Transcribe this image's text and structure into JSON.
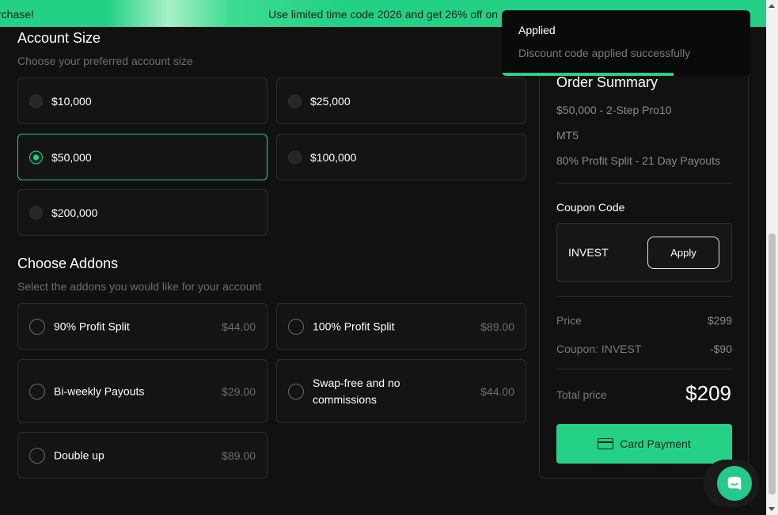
{
  "banner": {
    "left_text": "rchase!",
    "center_text": "Use limited time code 2026 and get 26% off on"
  },
  "account_size": {
    "title": "Account Size",
    "subtitle": "Choose your preferred account size",
    "options": [
      {
        "label": "$10,000",
        "selected": false
      },
      {
        "label": "$25,000",
        "selected": false
      },
      {
        "label": "$50,000",
        "selected": true
      },
      {
        "label": "$100,000",
        "selected": false
      },
      {
        "label": "$200,000",
        "selected": false
      }
    ]
  },
  "addons": {
    "title": "Choose Addons",
    "subtitle": "Select the addons you would like for your account",
    "options": [
      {
        "label": "90% Profit Split",
        "price": "$44.00"
      },
      {
        "label": "100% Profit Split",
        "price": "$89.00"
      },
      {
        "label": "Bi-weekly Payouts",
        "price": "$29.00"
      },
      {
        "label": "Swap-free and no commissions",
        "price": "$44.00"
      },
      {
        "label": "Double up",
        "price": "$89.00"
      }
    ]
  },
  "toast": {
    "title": "Applied",
    "message": "Discount code applied successfully",
    "progress_fraction": 0.69
  },
  "summary": {
    "title": "Order Summary",
    "lines": [
      "$50,000 - 2-Step Pro10",
      "MT5",
      "80% Profit Split - 21 Day Payouts"
    ],
    "coupon_label": "Coupon Code",
    "coupon_value": "INVEST",
    "apply_label": "Apply",
    "price_label": "Price",
    "price_value": "$299",
    "discount_label": "Coupon: INVEST",
    "discount_value": "-$90",
    "total_label": "Total price",
    "total_value": "$209",
    "pay_label": "Card Payment"
  },
  "colors": {
    "accent": "#25d186",
    "background": "#111111"
  }
}
